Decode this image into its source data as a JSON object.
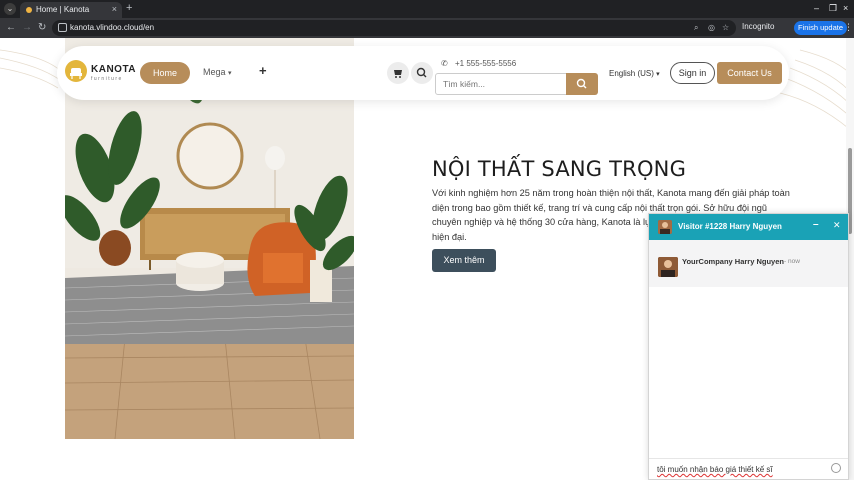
{
  "browser": {
    "tab_title": "Home | Kanota",
    "url": "kanota.vlindoo.cloud/en",
    "incognito_label": "Incognito",
    "update_label": "Finish update"
  },
  "header": {
    "logo_name": "KANOTA",
    "logo_sub": "furniture",
    "nav_home": "Home",
    "nav_mega": "Mega",
    "phone": "+1 555-555-5556",
    "search_placeholder": "Tìm kiếm...",
    "language": "English (US)",
    "sign_in": "Sign in",
    "contact": "Contact Us"
  },
  "hero": {
    "title": "NỘI THẤT SANG TRỌNG",
    "text": "Với kinh nghiệm hơn 25 năm trong hoàn thiện nội thất, Kanota mang đến giải pháp toàn diện trong bao gồm thiết kế, trang trí và cung cấp nội thất trọn gói. Sở hữu đội ngũ chuyên nghiệp và hệ thống 30 cửa hàng, Kanota là lựa chọn hàng đầu cho không gian hiện đại.",
    "button": "Xem thêm"
  },
  "chat": {
    "title": "Visitor #1228 Harry Nguyen",
    "sender": "YourCompany Harry Nguyen",
    "time": "- now",
    "typed": "tôi muốn nhận báo giá thiết kế sĩ"
  },
  "colors": {
    "accent": "#b78d5a",
    "chat_header": "#1aa2b6",
    "hero_button": "#3d4f5c"
  }
}
